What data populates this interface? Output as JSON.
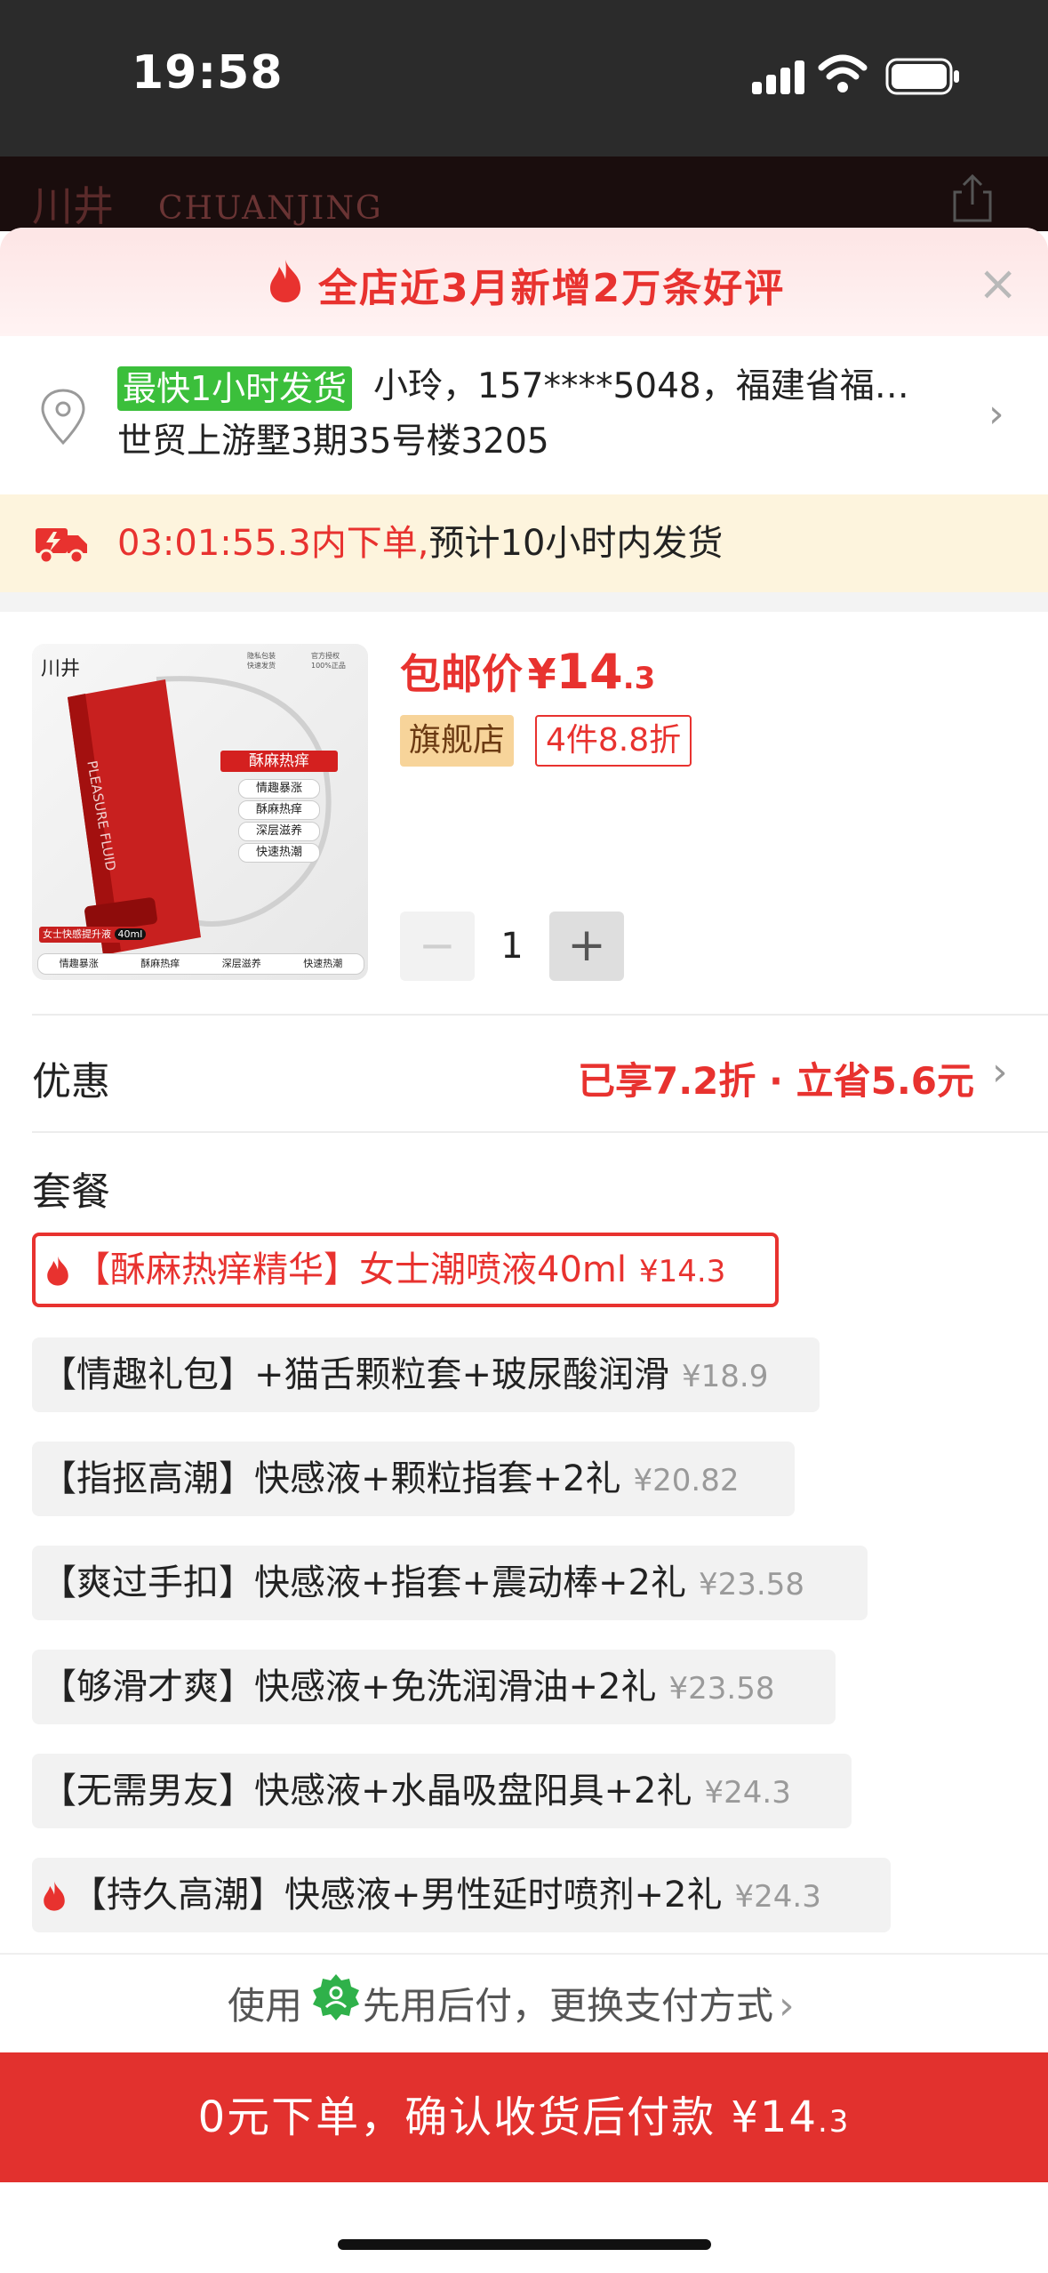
{
  "status_bar": {
    "time": "19:58"
  },
  "store": {
    "logo_text": "川井",
    "brand": "CHUANJING"
  },
  "promo_banner": {
    "text": "全店近3月新增2万条好评"
  },
  "address": {
    "fast_badge": "最快1小时发货",
    "line1": "小玲，157****5048，福建省福…",
    "line2": "世贸上游墅3期35号楼3205"
  },
  "delivery": {
    "countdown": "03:01:55.3内下单,",
    "estimate": "预计10小时内发货"
  },
  "product": {
    "image_texts": {
      "logo": "川井",
      "badge1": "隐私包装\n快速发货",
      "badge2": "官方授权\n100%正品",
      "bottle": "PLEASURE FLUID",
      "main_tag": "酥麻热痒",
      "features": [
        "情趣暴涨",
        "酥麻热痒",
        "深层滋养",
        "快速热潮"
      ],
      "volume_tag": "女士快感提升液",
      "volume": "40ml"
    },
    "price_label": "包邮价",
    "price_symbol": "¥",
    "price_int": "14",
    "price_dec": ".3",
    "tag_store": "旗舰店",
    "tag_discount": "4件8.8折",
    "quantity": "1"
  },
  "discount": {
    "label": "优惠",
    "value": "已享7.2折 · 立省5.6元"
  },
  "packages": {
    "title": "套餐",
    "items": [
      {
        "name": "【酥麻热痒精华】女士潮喷液40ml",
        "price": "¥14.3",
        "selected": true,
        "hot": true
      },
      {
        "name": "【情趣礼包】+猫舌颗粒套+玻尿酸润滑",
        "price": "¥18.9",
        "selected": false,
        "hot": false
      },
      {
        "name": "【指抠高潮】快感液+颗粒指套+2礼",
        "price": "¥20.82",
        "selected": false,
        "hot": false
      },
      {
        "name": "【爽过手扣】快感液+指套+震动棒+2礼",
        "price": "¥23.58",
        "selected": false,
        "hot": false
      },
      {
        "name": "【够滑才爽】快感液+免洗润滑油+2礼",
        "price": "¥23.58",
        "selected": false,
        "hot": false
      },
      {
        "name": "【无需男友】快感液+水晶吸盘阳具+2礼",
        "price": "¥24.3",
        "selected": false,
        "hot": false
      },
      {
        "name": "【持久高潮】快感液+男性延时喷剂+2礼",
        "price": "¥24.3",
        "selected": false,
        "hot": true
      }
    ]
  },
  "payment": {
    "prefix": "使用",
    "method": "先用后付，更换支付方式"
  },
  "checkout": {
    "text": "0元下单，确认收货后付款 ¥14",
    "dec": ".3"
  },
  "colors": {
    "accent": "#e8322f",
    "fast_badge": "#3bbf3b",
    "delivery_bg": "#fdf4dd",
    "button": "#e2312e"
  }
}
